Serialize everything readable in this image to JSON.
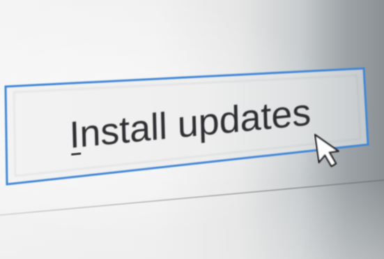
{
  "dialog": {
    "install_button": {
      "label_accel": "I",
      "label_rest": "nstall updates",
      "focused": true,
      "focus_color": "#3f86d6"
    }
  },
  "cursor": {
    "icon": "arrow-cursor-icon",
    "color": "#ffffff",
    "outline": "#2b2b2b"
  },
  "colors": {
    "text": "#2e2f31",
    "background_light": "#f2f2f2",
    "background_shadow": "#8b9194"
  }
}
